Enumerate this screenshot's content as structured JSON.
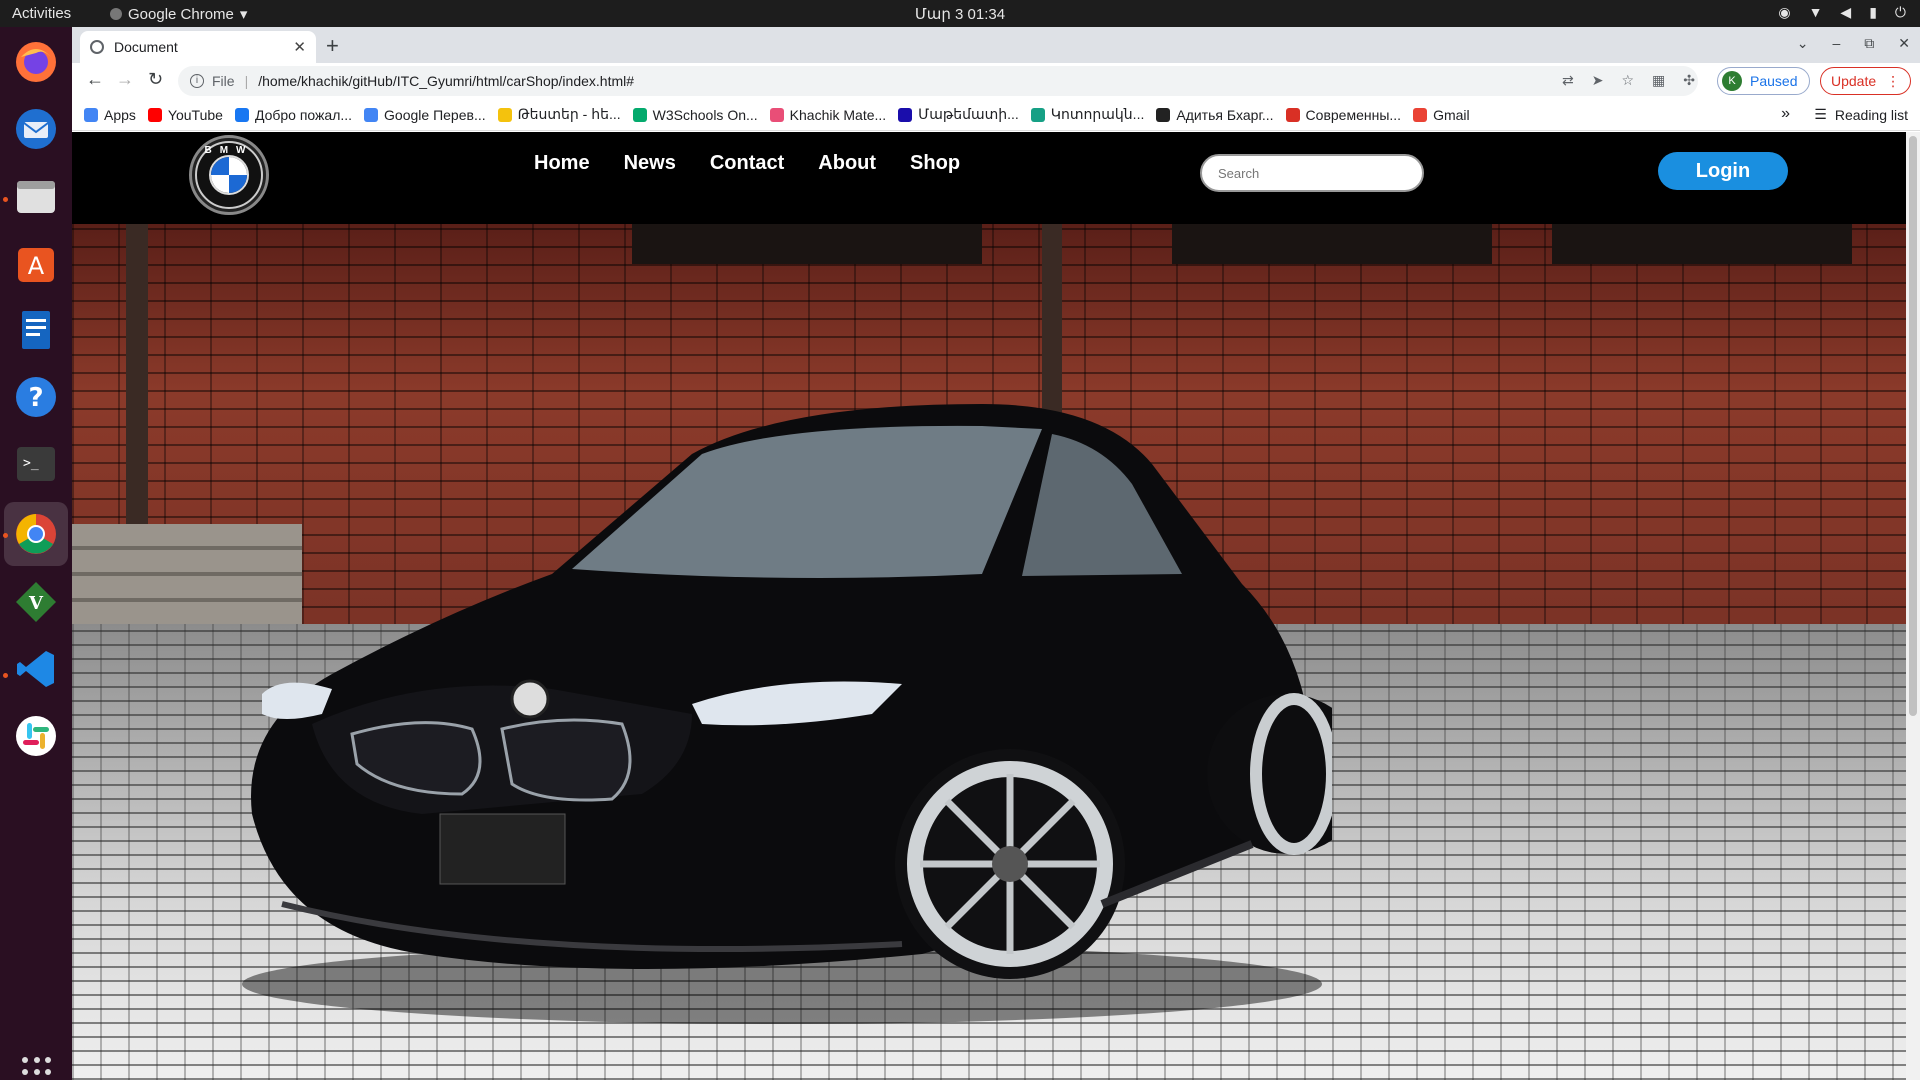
{
  "system": {
    "activities": "Activities",
    "app_menu": "Google Chrome",
    "clock": "Մար 3  01:34"
  },
  "browser": {
    "tab_title": "Document",
    "url_scheme": "File",
    "url": "/home/khachik/gitHub/ITC_Gyumri/html/carShop/index.html#",
    "profile_initial": "K",
    "profile_status": "Paused",
    "update_label": "Update",
    "bookmarks": [
      {
        "label": "Apps",
        "color": "#4285f4"
      },
      {
        "label": "YouTube",
        "color": "#ff0000"
      },
      {
        "label": "Добро пожал...",
        "color": "#1877f2"
      },
      {
        "label": "Google Перев...",
        "color": "#4285f4"
      },
      {
        "label": "Թեստեր - հե...",
        "color": "#f4c20d"
      },
      {
        "label": "W3Schools On...",
        "color": "#04aa6d"
      },
      {
        "label": "Khachik Mate...",
        "color": "#e94e77"
      },
      {
        "label": "Մաթեմատի...",
        "color": "#1a0dab"
      },
      {
        "label": "Կոտորակն...",
        "color": "#16a085"
      },
      {
        "label": "Адитья Бхарг...",
        "color": "#222222"
      },
      {
        "label": "Современны...",
        "color": "#d93025"
      },
      {
        "label": "Gmail",
        "color": "#ea4335"
      }
    ],
    "bookmarks_more": "»",
    "reading_list": "Reading list"
  },
  "site": {
    "logo_letters": "BMW",
    "nav": [
      "Home",
      "News",
      "Contact",
      "About",
      "Shop"
    ],
    "search_placeholder": "Search",
    "login_label": "Login"
  }
}
